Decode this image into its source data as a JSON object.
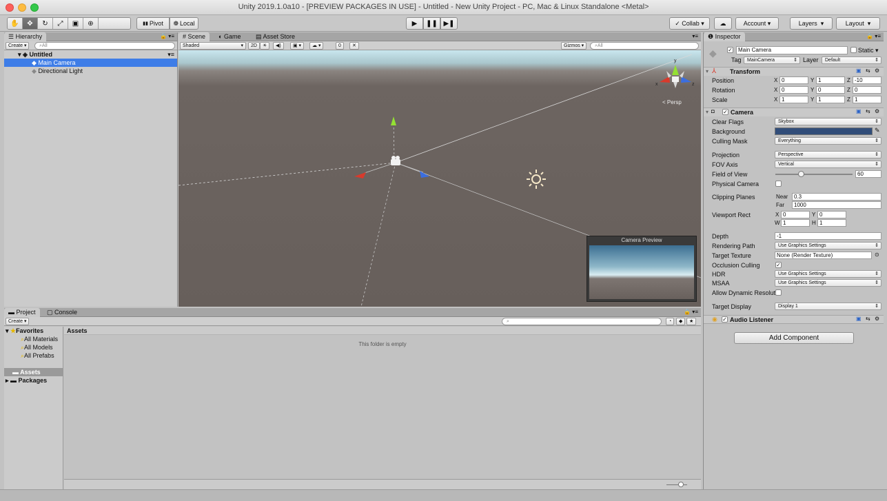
{
  "window": {
    "title": "Unity 2019.1.0a10 - [PREVIEW PACKAGES IN USE] - Untitled - New Unity Project - PC, Mac & Linux Standalone <Metal>"
  },
  "toolbar": {
    "pivot": "Pivot",
    "local": "Local",
    "collab": "Collab",
    "account": "Account",
    "layers": "Layers",
    "layout": "Layout"
  },
  "hierarchy": {
    "tab": "Hierarchy",
    "create": "Create",
    "search_placeholder": "All",
    "scene": "Untitled",
    "items": [
      "Main Camera",
      "Directional Light"
    ]
  },
  "scene": {
    "tabs": [
      "Scene",
      "Game",
      "Asset Store"
    ],
    "shading": "Shaded",
    "mode_2d": "2D",
    "gizmos": "Gizmos",
    "search_placeholder": "All",
    "hidden_count": "0",
    "persp": "Persp",
    "preview_title": "Camera Preview"
  },
  "project": {
    "tabs": [
      "Project",
      "Console"
    ],
    "create": "Create",
    "favorites": "Favorites",
    "favorite_items": [
      "All Materials",
      "All Models",
      "All Prefabs"
    ],
    "assets": "Assets",
    "packages": "Packages",
    "breadcrumb": "Assets",
    "empty": "This folder is empty"
  },
  "inspector": {
    "tab": "Inspector",
    "object_name": "Main Camera",
    "static": "Static",
    "tag_label": "Tag",
    "tag": "MainCamera",
    "layer_label": "Layer",
    "layer": "Default",
    "transform": {
      "title": "Transform",
      "position_label": "Position",
      "rotation_label": "Rotation",
      "scale_label": "Scale",
      "position": [
        "0",
        "1",
        "-10"
      ],
      "rotation": [
        "0",
        "0",
        "0"
      ],
      "scale": [
        "1",
        "1",
        "1"
      ]
    },
    "camera": {
      "title": "Camera",
      "clear_flags_label": "Clear Flags",
      "clear_flags": "Skybox",
      "background_label": "Background",
      "culling_mask_label": "Culling Mask",
      "culling_mask": "Everything",
      "projection_label": "Projection",
      "projection": "Perspective",
      "fov_axis_label": "FOV Axis",
      "fov_axis": "Vertical",
      "fov_label": "Field of View",
      "fov": "60",
      "physical_label": "Physical Camera",
      "clipping_label": "Clipping Planes",
      "near_label": "Near",
      "near": "0.3",
      "far_label": "Far",
      "far": "1000",
      "viewport_label": "Viewport Rect",
      "vx": "0",
      "vy": "0",
      "vw": "1",
      "vh": "1",
      "depth_label": "Depth",
      "depth": "-1",
      "rendering_path_label": "Rendering Path",
      "rendering_path": "Use Graphics Settings",
      "target_texture_label": "Target Texture",
      "target_texture": "None (Render Texture)",
      "occlusion_label": "Occlusion Culling",
      "hdr_label": "HDR",
      "hdr": "Use Graphics Settings",
      "msaa_label": "MSAA",
      "msaa": "Use Graphics Settings",
      "dynres_label": "Allow Dynamic Resolut",
      "target_display_label": "Target Display",
      "target_display": "Display 1"
    },
    "audio_listener": "Audio Listener",
    "add_component": "Add Component"
  },
  "axis_labels": {
    "x": "X",
    "y": "Y",
    "z": "Z",
    "w": "W",
    "h": "H"
  },
  "colors": {
    "accent": "#3e7de7",
    "sky": "#c5e3ea",
    "ground": "#6b625e",
    "bg_swatch": "#314d79"
  }
}
